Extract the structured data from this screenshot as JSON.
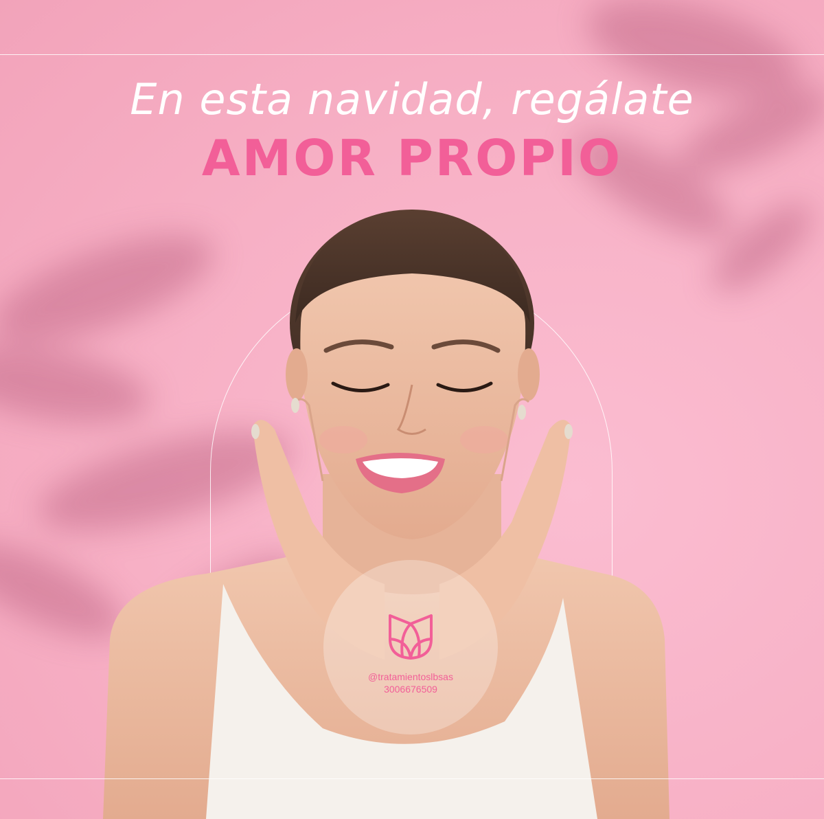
{
  "banner": {
    "subtitle": "En esta navidad, regálate",
    "title": "AMOR PROPIO"
  },
  "badge": {
    "handle": "@tratamientoslbsas",
    "phone": "3006676509",
    "logo_icon": "tulip-logo-icon"
  },
  "colors": {
    "background": "#f9b3c8",
    "accent": "#f25f98",
    "line": "#ffffff"
  }
}
